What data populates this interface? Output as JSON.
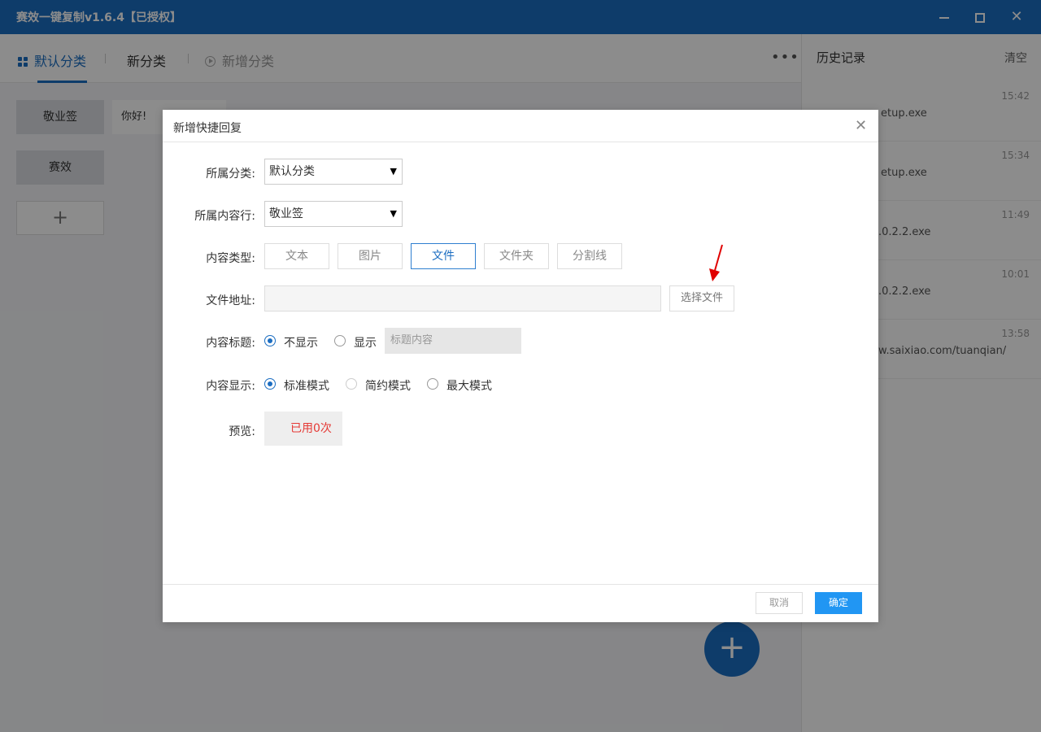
{
  "app": {
    "title": "赛效一键复制v1.6.4【已授权】"
  },
  "tabs": [
    {
      "label": "默认分类",
      "active": true
    },
    {
      "label": "新分类",
      "active": false
    },
    {
      "label": "新增分类",
      "active": false
    }
  ],
  "more_label": "•••",
  "categories": [
    "敬业签",
    "赛效"
  ],
  "add_category_symbol": "+",
  "content_items": [
    "你好!"
  ],
  "fab_symbol": "+",
  "history": {
    "title": "历史记录",
    "clear_label": "清空",
    "items": [
      {
        "time": "15:42",
        "text": "etup.exe"
      },
      {
        "time": "15:34",
        "text": "etup.exe"
      },
      {
        "time": "11:49",
        "text": ".0.2.2.exe"
      },
      {
        "time": "10:01",
        "text": ".0.2.2.exe"
      },
      {
        "time": "13:58",
        "text": "w.saixiao.com/tuanqian/"
      }
    ]
  },
  "dialog": {
    "title": "新增快捷回复",
    "category_label": "所属分类:",
    "category_value": "默认分类",
    "row_label": "所属内容行:",
    "row_value": "敬业签",
    "type_label": "内容类型:",
    "types": [
      "文本",
      "图片",
      "文件",
      "文件夹",
      "分割线"
    ],
    "active_type": "文件",
    "file_label": "文件地址:",
    "file_value": "",
    "choose_file_label": "选择文件",
    "title_label": "内容标题:",
    "title_options": [
      "不显示",
      "显示"
    ],
    "title_placeholder": "标题内容",
    "display_label": "内容显示:",
    "display_options": [
      "标准模式",
      "简约模式",
      "最大模式"
    ],
    "preview_label": "预览:",
    "preview_text": "已用0次",
    "cancel_label": "取消",
    "ok_label": "确定"
  },
  "colors": {
    "accent": "#1b6dc1",
    "primary_button": "#2196f3",
    "preview_text": "#e53935",
    "annotation_arrow": "#e00000"
  }
}
